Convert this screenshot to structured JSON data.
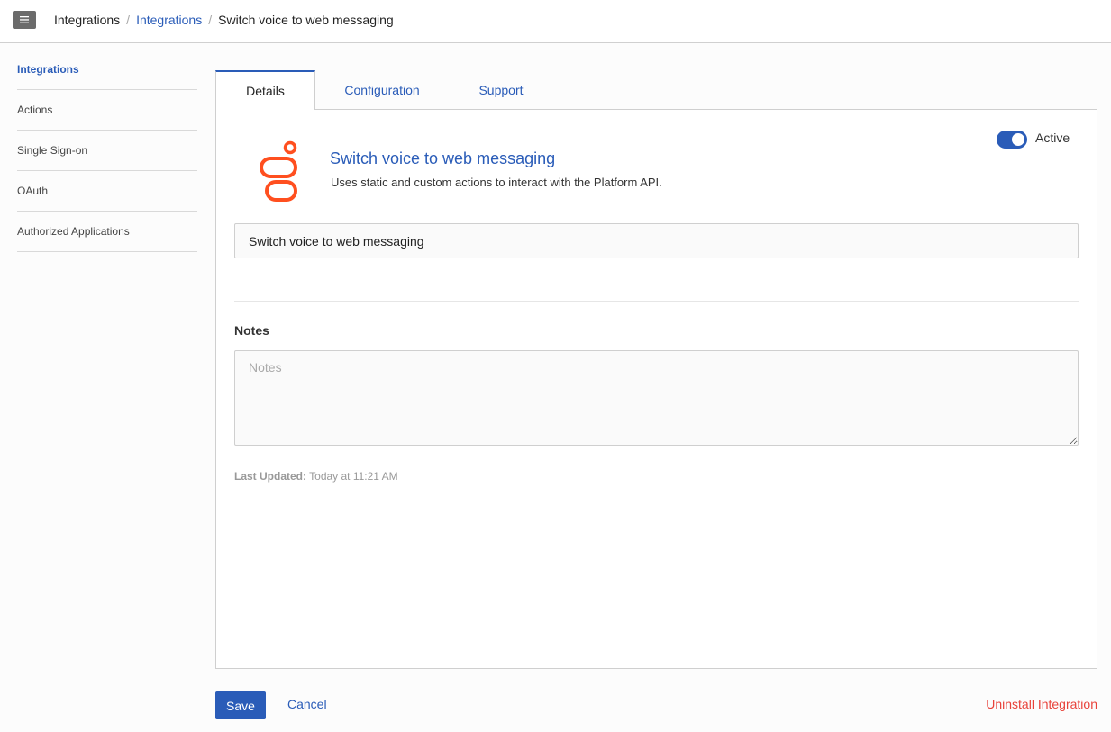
{
  "header": {
    "breadcrumb": {
      "root": "Integrations",
      "link": "Integrations",
      "current": "Switch voice to web messaging",
      "separator": "/"
    }
  },
  "sidebar": {
    "items": [
      {
        "label": "Integrations",
        "active": true
      },
      {
        "label": "Actions"
      },
      {
        "label": "Single Sign-on"
      },
      {
        "label": "OAuth"
      },
      {
        "label": "Authorized Applications"
      }
    ]
  },
  "tabs": [
    {
      "label": "Details",
      "active": true
    },
    {
      "label": "Configuration"
    },
    {
      "label": "Support"
    }
  ],
  "details": {
    "title": "Switch voice to web messaging",
    "description": "Uses static and custom actions to interact with the Platform API.",
    "status_label": "Active",
    "name_value": "Switch voice to web messaging",
    "notes_label": "Notes",
    "notes_placeholder": "Notes",
    "last_updated_label": "Last Updated:",
    "last_updated_value": "Today at 11:21 AM"
  },
  "footer": {
    "save_label": "Save",
    "cancel_label": "Cancel",
    "uninstall_label": "Uninstall Integration"
  },
  "colors": {
    "accent": "#2a5cb8",
    "logo": "#ff4f1f",
    "danger": "#e8423a"
  },
  "icons": {
    "menu": "hamburger-icon",
    "logo": "genesys-logo-icon"
  }
}
